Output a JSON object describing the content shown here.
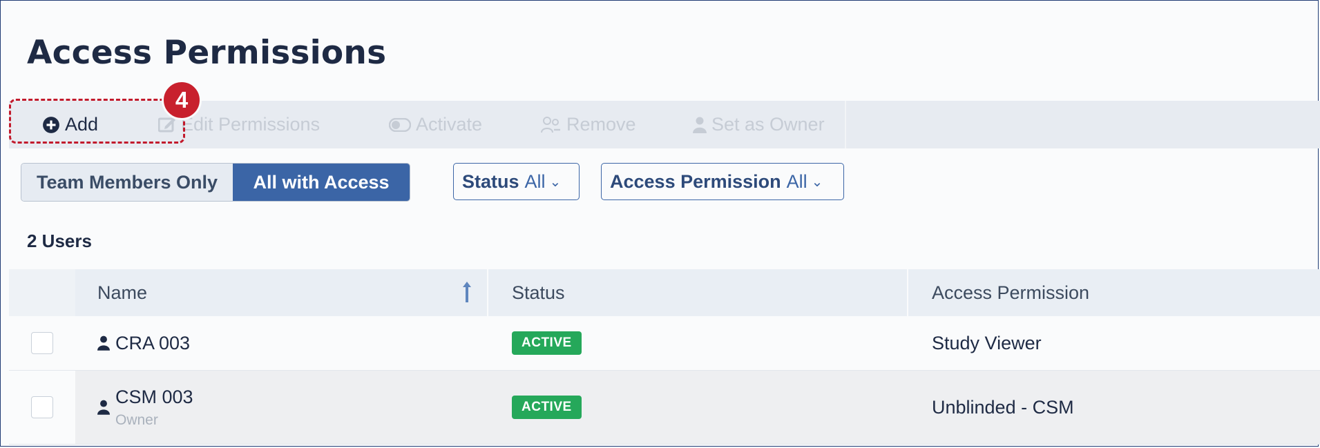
{
  "page": {
    "title": "Access Permissions"
  },
  "toolbar": {
    "add_label": "Add",
    "edit_label": "Edit Permissions",
    "activate_label": "Activate",
    "remove_label": "Remove",
    "owner_label": "Set as Owner"
  },
  "callout": {
    "step_number": "4"
  },
  "view_toggle": {
    "team_label": "Team Members Only",
    "all_label": "All with Access",
    "selected": "All with Access"
  },
  "filters": {
    "status_label": "Status",
    "status_value": "All",
    "access_label": "Access Permission",
    "access_value": "All"
  },
  "summary": {
    "count_label": "2 Users"
  },
  "table": {
    "headers": {
      "name": "Name",
      "status": "Status",
      "access": "Access Permission"
    },
    "rows": [
      {
        "name": "CRA 003",
        "subtitle": "",
        "status": "ACTIVE",
        "access": "Study Viewer"
      },
      {
        "name": "CSM 003",
        "subtitle": "Owner",
        "status": "ACTIVE",
        "access": "Unblinded - CSM"
      }
    ]
  },
  "colors": {
    "accent": "#3b65a6",
    "callout": "#c8202d",
    "status_active": "#25a85a",
    "title": "#1e2a44"
  },
  "icons": {
    "add": "plus-circle-icon",
    "edit": "edit-icon",
    "activate": "toggle-icon",
    "remove": "remove-users-icon",
    "owner": "user-icon",
    "sort": "arrow-up-icon"
  }
}
